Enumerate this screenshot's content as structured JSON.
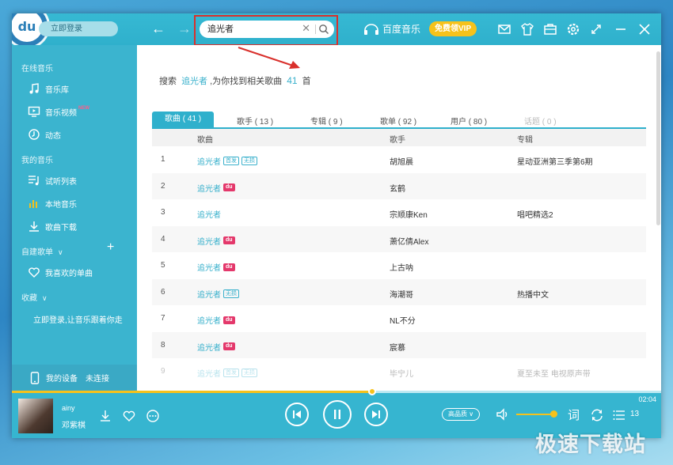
{
  "header": {
    "logo_text": "du",
    "login_label": "立即登录",
    "search_value": "追光者",
    "brand_name": "百度音乐",
    "vip_label": "免费领VIP"
  },
  "sidebar": {
    "online_title": "在线音乐",
    "online_items": [
      "音乐库",
      "音乐视频",
      "动态"
    ],
    "new_badge": "NEW",
    "my_title": "我的音乐",
    "my_items": [
      "试听列表",
      "本地音乐",
      "歌曲下载"
    ],
    "custom_title": "自建歌单",
    "favorite_label": "我喜欢的单曲",
    "collection_title": "收藏",
    "login_hint": "立即登录,让音乐跟着你走",
    "device_label": "我的设备",
    "device_status": "未连接"
  },
  "result": {
    "prefix": "搜索",
    "keyword": "追光者",
    "middle": ",为你找到相关歌曲",
    "count": "41",
    "suffix": "首"
  },
  "tabs": [
    {
      "label": "歌曲 ( 41 )",
      "active": true
    },
    {
      "label": "歌手 ( 13 )"
    },
    {
      "label": "专辑 ( 9 )"
    },
    {
      "label": "歌单 ( 92 )"
    },
    {
      "label": "用户 ( 80 )"
    },
    {
      "label": "话题 ( 0 )",
      "disabled": true
    }
  ],
  "table": {
    "columns": [
      "歌曲",
      "歌手",
      "专辑"
    ],
    "rows": [
      {
        "num": "1",
        "song": "追光者",
        "tags": [
          "首发",
          "无损"
        ],
        "artist": "胡旭晨",
        "album": "星动亚洲第三季第6期"
      },
      {
        "num": "2",
        "song": "追光者",
        "tags": [
          "du"
        ],
        "artist": "玄鹤",
        "album": ""
      },
      {
        "num": "3",
        "song": "追光者",
        "tags": [],
        "artist": "宗顺康Ken",
        "album": "唱吧精选2"
      },
      {
        "num": "4",
        "song": "追光者",
        "tags": [
          "du"
        ],
        "artist": "萧亿倩Alex",
        "album": ""
      },
      {
        "num": "5",
        "song": "追光者",
        "tags": [
          "du"
        ],
        "artist": "上古呐",
        "album": ""
      },
      {
        "num": "6",
        "song": "追光者",
        "tags": [
          "无损"
        ],
        "artist": "海潮哥",
        "album": "热播中文"
      },
      {
        "num": "7",
        "song": "追光者",
        "tags": [
          "du"
        ],
        "artist": "NL不分",
        "album": ""
      },
      {
        "num": "8",
        "song": "追光者",
        "tags": [
          "du"
        ],
        "artist": "宸慕",
        "album": ""
      },
      {
        "num": "9",
        "song": "追光者",
        "tags": [
          "首发",
          "无损"
        ],
        "artist": "毕宁儿",
        "album": "夏至未至 电视原声带"
      }
    ]
  },
  "player": {
    "track_title": "ainy",
    "track_artist": "邓紫棋",
    "time": "02:04",
    "progress": 0.555,
    "quality_label": "高品质",
    "lyric_label": "词",
    "playlist_count": "13",
    "volume": 1.0
  },
  "watermark": "极速下载站",
  "colors": {
    "accent": "#2fb0cc",
    "vip": "#f6c21b",
    "highlight_red": "#d9302c",
    "du_tag": "#e4386b"
  }
}
